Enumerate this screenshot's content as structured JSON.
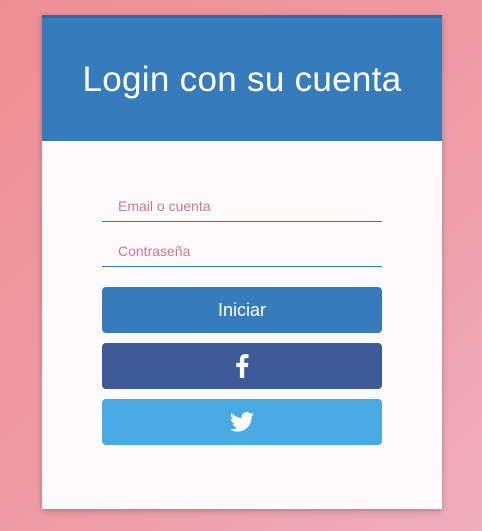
{
  "header": {
    "title": "Login con su cuenta"
  },
  "form": {
    "email": {
      "placeholder": "Email o cuenta",
      "value": ""
    },
    "password": {
      "placeholder": "Contraseña",
      "value": ""
    },
    "login_button_label": "Iniciar",
    "facebook_button": {
      "icon": "facebook-icon"
    },
    "twitter_button": {
      "icon": "twitter-icon"
    }
  },
  "colors": {
    "primary": "#367cbd",
    "facebook": "#3d5a99",
    "twitter": "#49a9e3",
    "placeholder": "#c87a90",
    "background": "#ef9aa3"
  }
}
